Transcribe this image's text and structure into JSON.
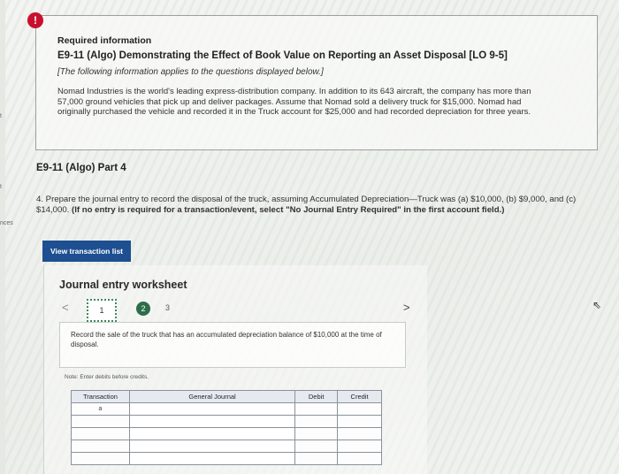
{
  "alert": {
    "icon": "exclamation-icon",
    "symbol": "!"
  },
  "info": {
    "heading": "Required information",
    "title": "E9-11 (Algo) Demonstrating the Effect of Book Value on Reporting an Asset Disposal [LO 9-5]",
    "note": "[The following information applies to the questions displayed below.]",
    "paragraph": "Nomad Industries is the world's leading express-distribution company. In addition to its 643 aircraft, the company has more than 57,000 ground vehicles that pick up and deliver packages. Assume that Nomad sold a delivery truck for $15,000. Nomad had originally purchased the vehicle and recorded it in the Truck account for $25,000 and had recorded depreciation for three years."
  },
  "edge_labels": {
    "label_1": "t",
    "label_2": "t",
    "label_3": "nces"
  },
  "part_title": "E9-11 (Algo) Part 4",
  "question": {
    "text": "4. Prepare the journal entry to record the disposal of the truck, assuming Accumulated Depreciation—Truck was (a) $10,000, (b) $9,000, and (c) $14,000.",
    "bold_text": "(If no entry is required for a transaction/event, select \"No Journal Entry Required\" in the first account field.)"
  },
  "buttons": {
    "view_transactions": "View transaction list"
  },
  "worksheet": {
    "title": "Journal entry worksheet",
    "prev_symbol": "<",
    "next_symbol": ">",
    "steps": [
      "1",
      "2",
      "3"
    ],
    "instruction": "Record the sale of the truck that has an accumulated depreciation balance of $10,000 at the time of disposal.",
    "note": "Note: Enter debits before credits.",
    "table": {
      "headers": [
        "Transaction",
        "General Journal",
        "Debit",
        "Credit"
      ],
      "first_transaction": "a",
      "row_count": 5
    }
  },
  "colors": {
    "alert_red": "#c8102e",
    "button_blue": "#1d4f91",
    "step_green": "#2c6e49",
    "header_gray": "#e6eaf0"
  }
}
